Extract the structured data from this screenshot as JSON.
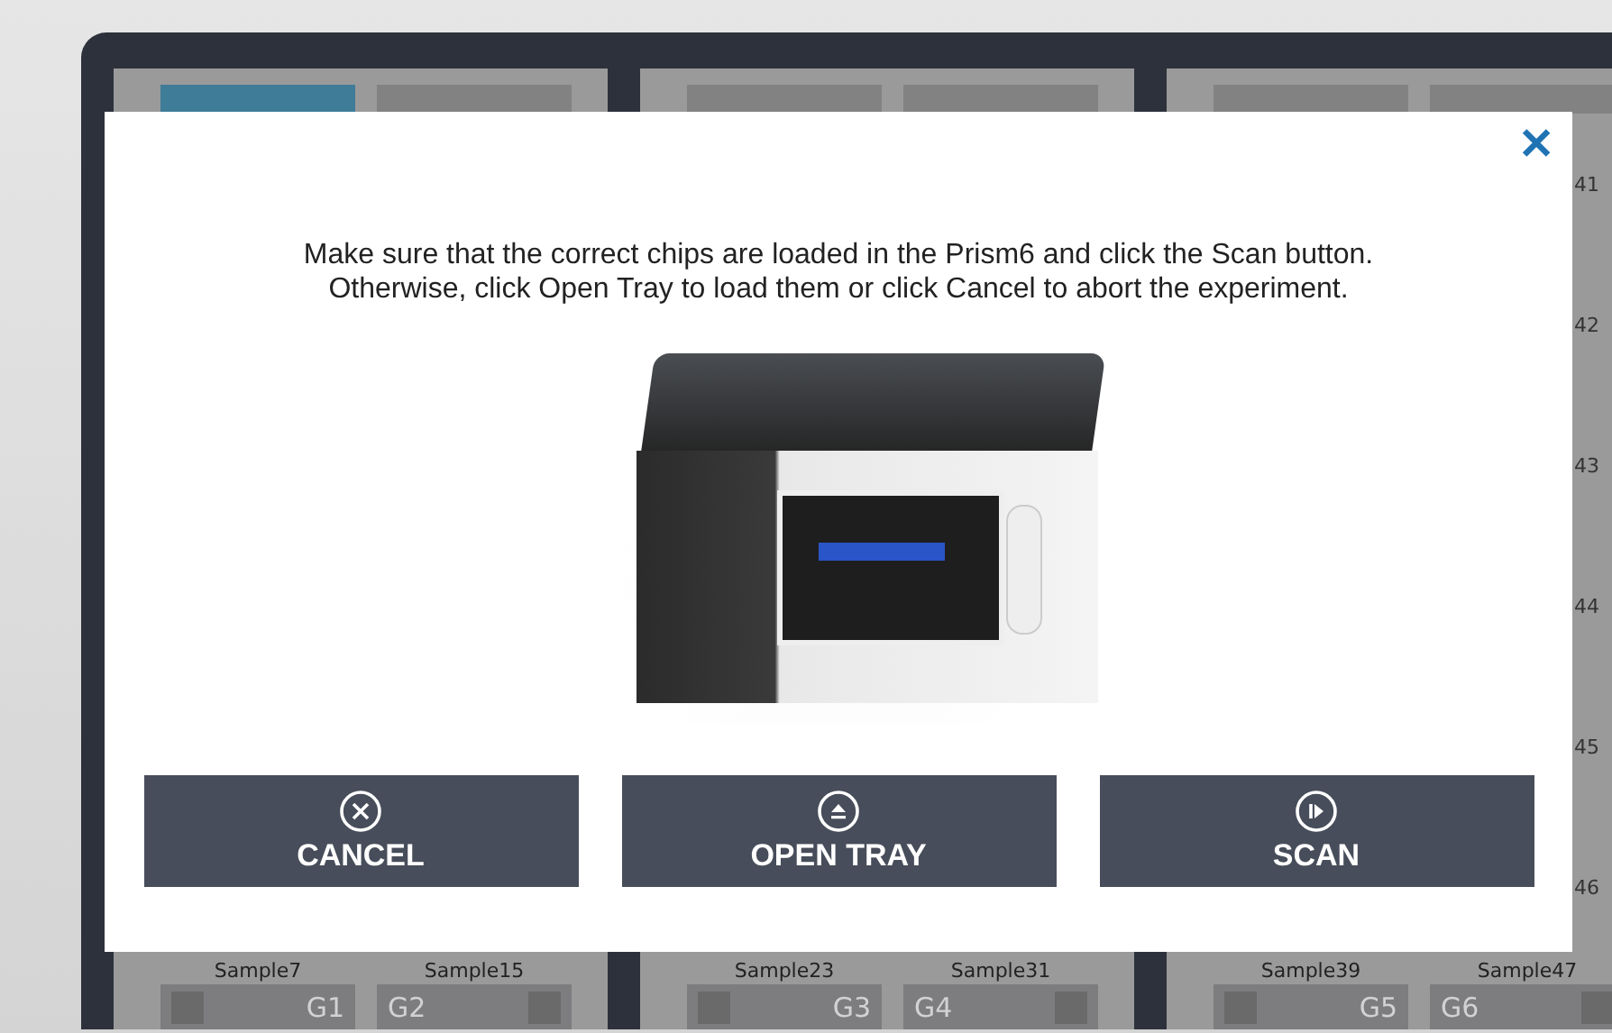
{
  "background": {
    "panels": [
      {
        "tabs": [
          {
            "selected": true
          },
          {
            "selected": false
          }
        ],
        "columns": [
          {
            "sample": "Sample7",
            "group": "G1"
          },
          {
            "sample": "Sample15",
            "group": "G2"
          }
        ]
      },
      {
        "tabs": [
          {
            "selected": false
          },
          {
            "selected": false
          }
        ],
        "columns": [
          {
            "sample": "Sample23",
            "group": "G3"
          },
          {
            "sample": "Sample31",
            "group": "G4"
          }
        ]
      },
      {
        "tabs": [
          {
            "selected": false
          },
          {
            "selected": false
          }
        ],
        "columns": [
          {
            "sample": "Sample39",
            "group": "G5"
          },
          {
            "labels": [
              "41",
              "42",
              "43",
              "44",
              "45",
              "46"
            ],
            "sample": "Sample47",
            "group": "G6"
          }
        ]
      }
    ]
  },
  "dialog": {
    "close": "✕",
    "message": [
      "Make sure that the correct chips are loaded in the Prism6 and click the Scan button.",
      "Otherwise, click Open Tray to load them or click Cancel to abort the experiment."
    ],
    "buttons": [
      {
        "kind": "cancel",
        "label": "CANCEL"
      },
      {
        "kind": "eject",
        "label": "OPEN TRAY"
      },
      {
        "kind": "scan",
        "label": "SCAN"
      }
    ]
  }
}
